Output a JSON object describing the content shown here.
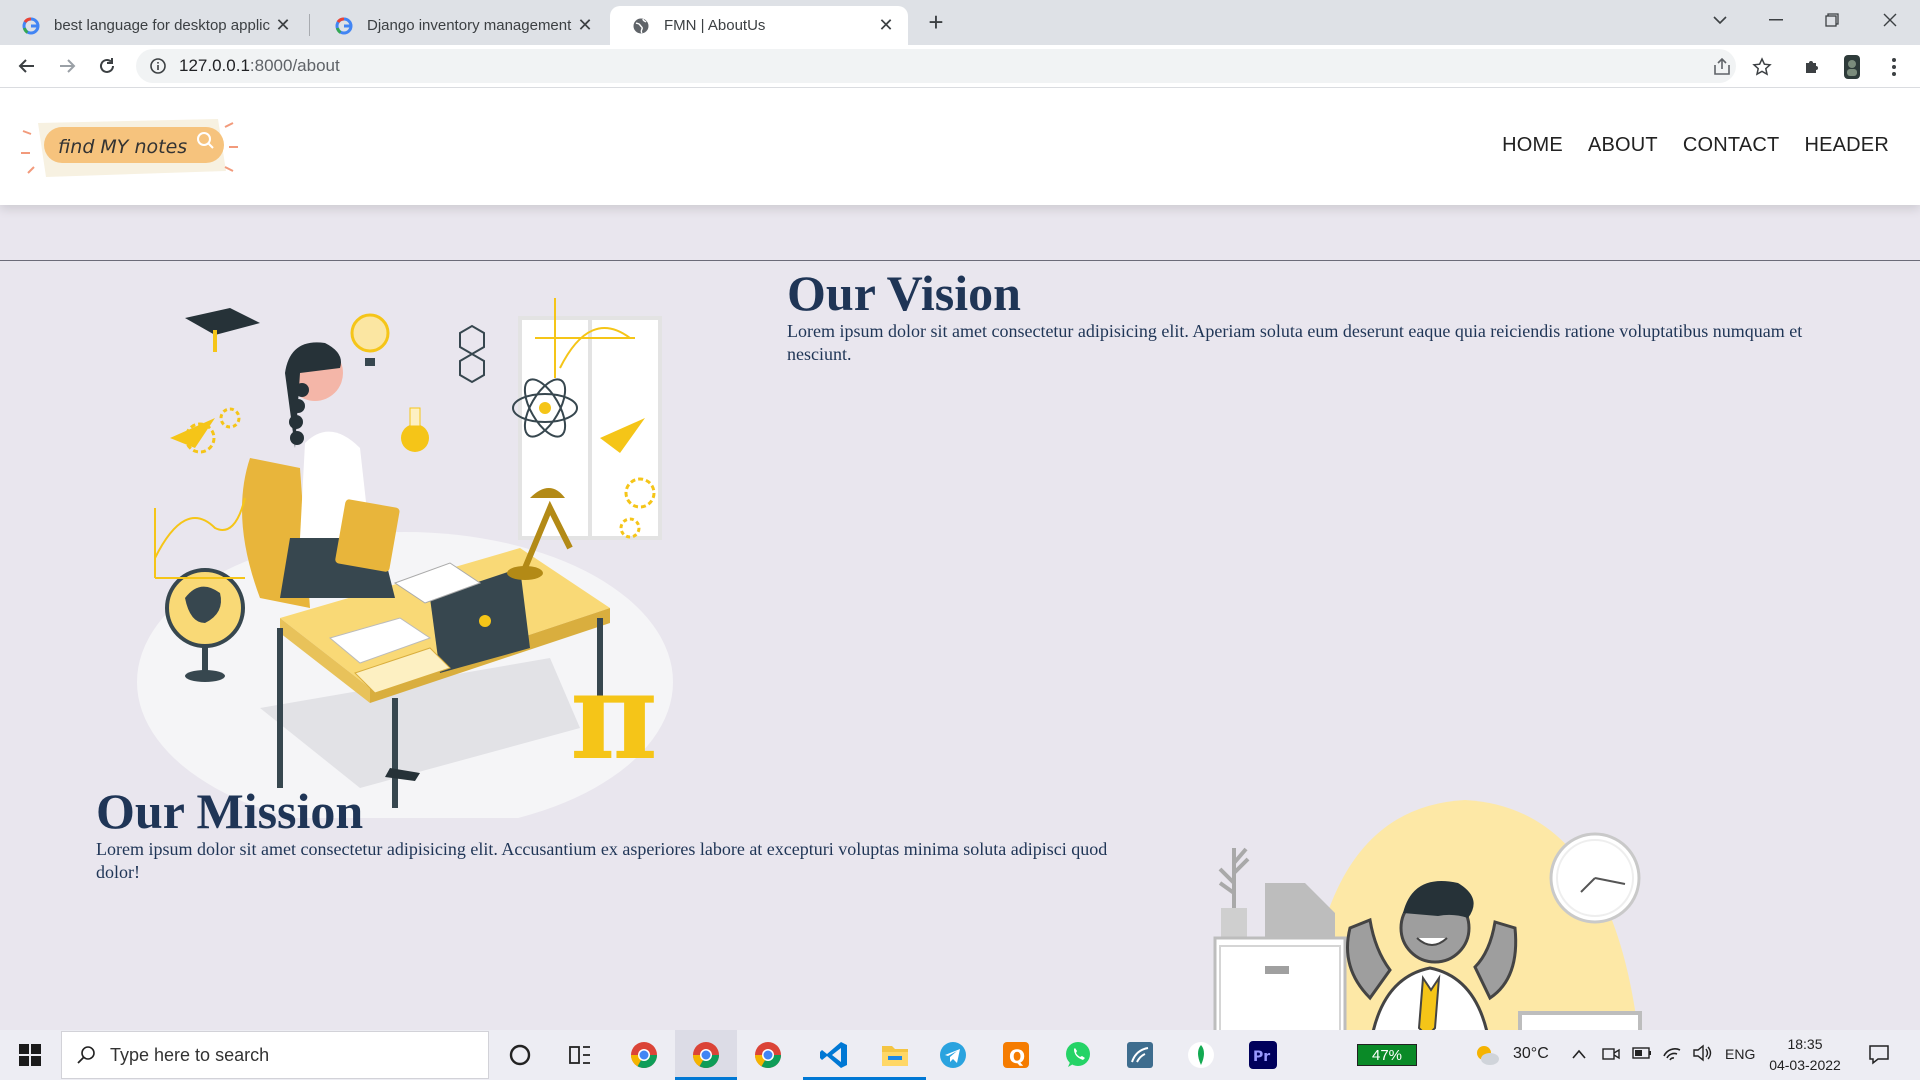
{
  "browser": {
    "tabs": [
      {
        "title": "best language for desktop applic",
        "favicon": "google-icon",
        "active": false
      },
      {
        "title": "Django inventory management s",
        "favicon": "google-icon",
        "active": false
      },
      {
        "title": "FMN | AboutUs",
        "favicon": "globe-icon",
        "active": true
      }
    ],
    "url_host": "127.0.0.1",
    "url_rest": ":8000/about"
  },
  "site": {
    "logo_text": "find MY notes",
    "nav": [
      "HOME",
      "ABOUT",
      "CONTACT",
      "HEADER"
    ]
  },
  "vision": {
    "title": "Our Vision",
    "text": "Lorem ipsum dolor sit amet consectetur adipisicing elit. Aperiam soluta eum deserunt eaque quia reiciendis ratione voluptatibus numquam et nesciunt."
  },
  "mission": {
    "title": "Our Mission",
    "text": "Lorem ipsum dolor sit amet consectetur adipisicing elit. Accusantium ex asperiores labore at excepturi voluptas minima soluta adipisci quod dolor!"
  },
  "taskbar": {
    "search_placeholder": "Type here to search",
    "battery": "47%",
    "weather": "30°C",
    "language": "ENG",
    "time": "18:35",
    "date": "04-03-2022"
  },
  "colors": {
    "heading": "#1f3556",
    "page_bg": "#e9e6ee",
    "accent_yellow": "#f5c518"
  }
}
